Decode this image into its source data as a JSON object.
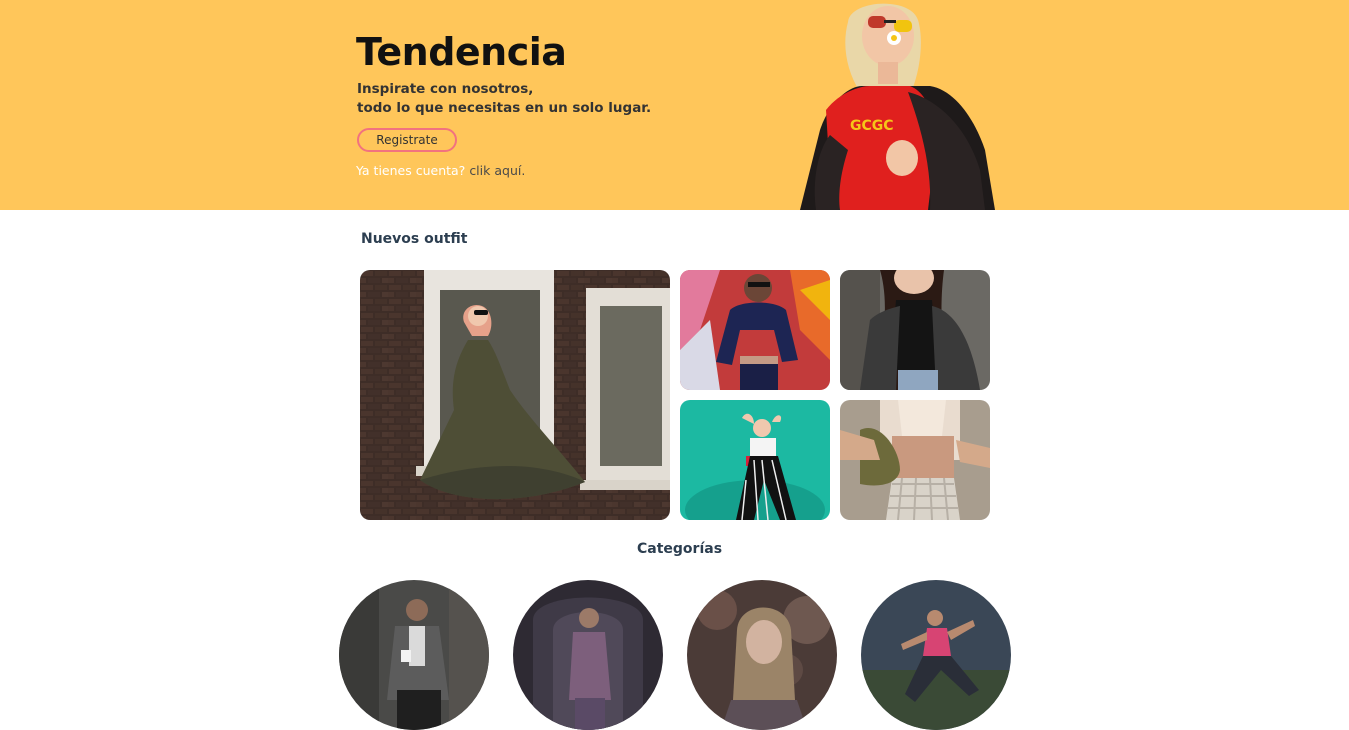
{
  "hero": {
    "title": "Tendencia",
    "subtitle_line1": "Inspirate con nosotros,",
    "subtitle_line2": "todo lo que necesitas en un solo lugar.",
    "register_label": "Registrate",
    "login_question": "Ya tienes cuenta?",
    "login_link": "clik aquí."
  },
  "sections": {
    "new_outfits_title": "Nuevos outfit",
    "categories_title": "Categorías"
  },
  "colors": {
    "hero_bg": "#FFC65A",
    "button_border": "#F2727F"
  }
}
